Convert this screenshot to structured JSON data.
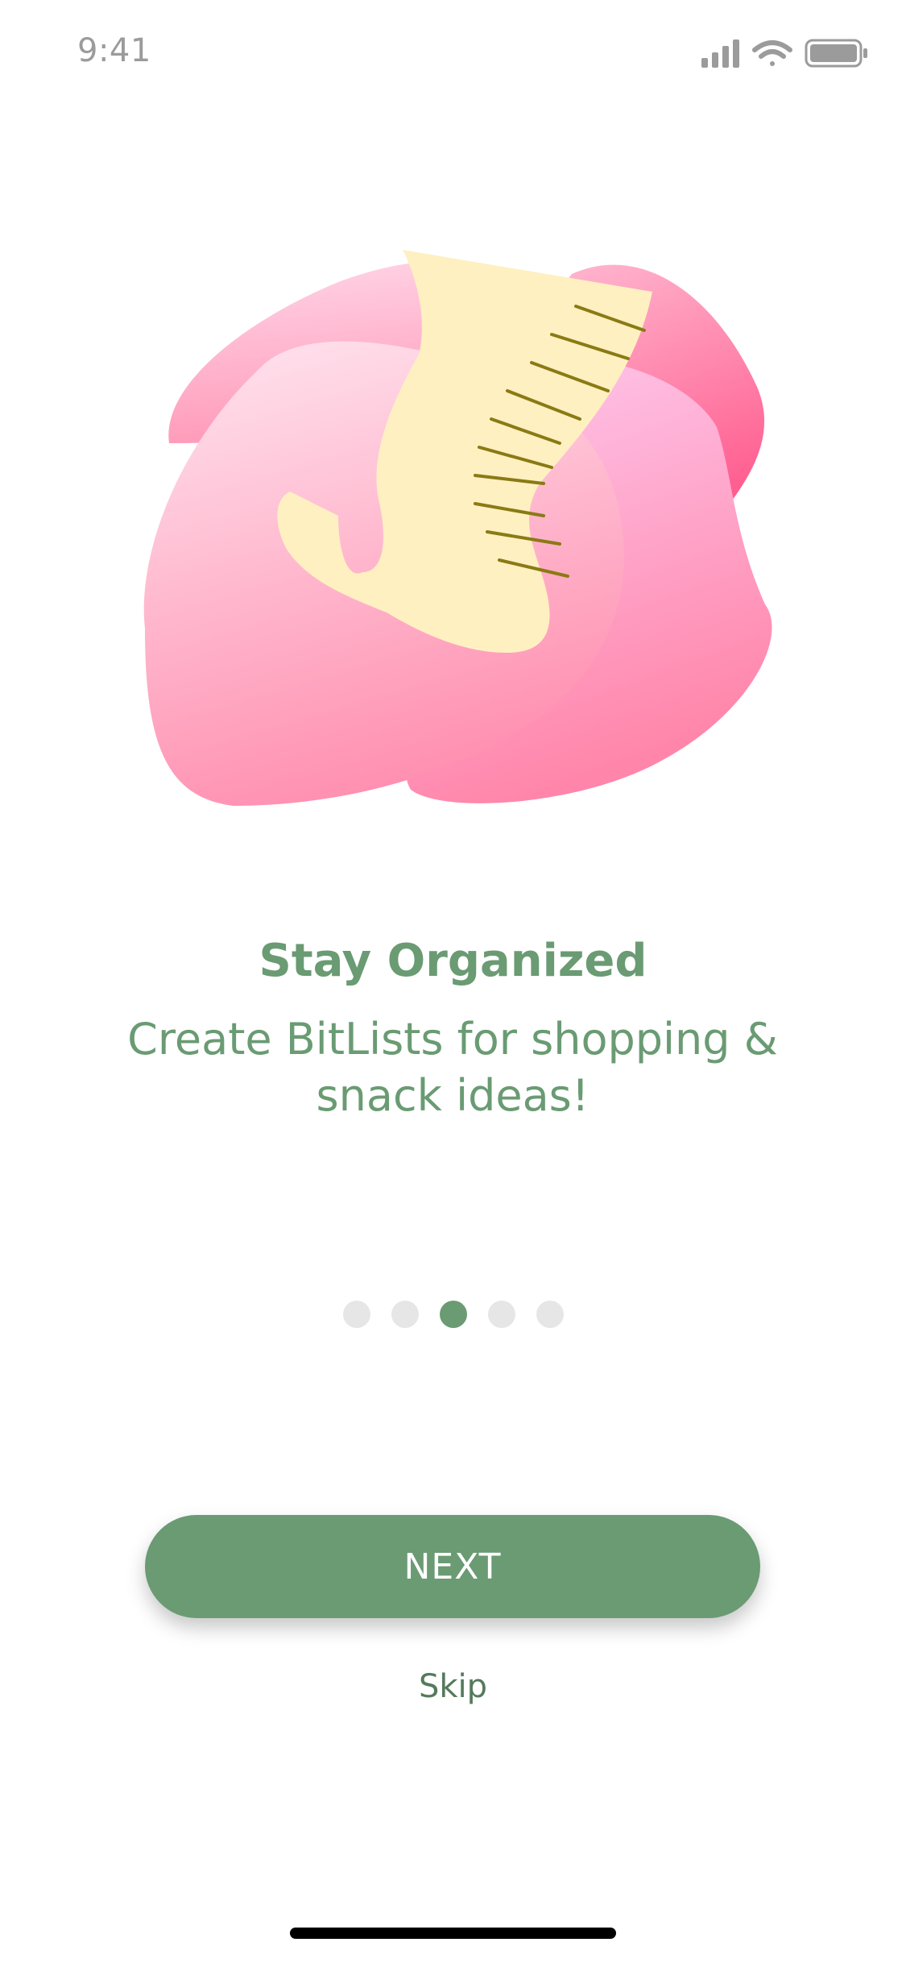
{
  "status_bar": {
    "time": "9:41",
    "icons": [
      "signal-icon",
      "wifi-icon",
      "battery-icon"
    ]
  },
  "onboarding": {
    "illustration": "receipt-list-illustration",
    "title": "Stay Organized",
    "description": "Create BitLists for shopping & snack ideas!",
    "pager": {
      "total": 5,
      "active_index": 2
    }
  },
  "actions": {
    "next_label": "NEXT",
    "skip_label": "Skip"
  },
  "colors": {
    "accent": "#6a9b73",
    "dot_inactive": "#e6e6e6",
    "blob_pink": "#ff8fb0",
    "paper": "#fff1c4"
  }
}
